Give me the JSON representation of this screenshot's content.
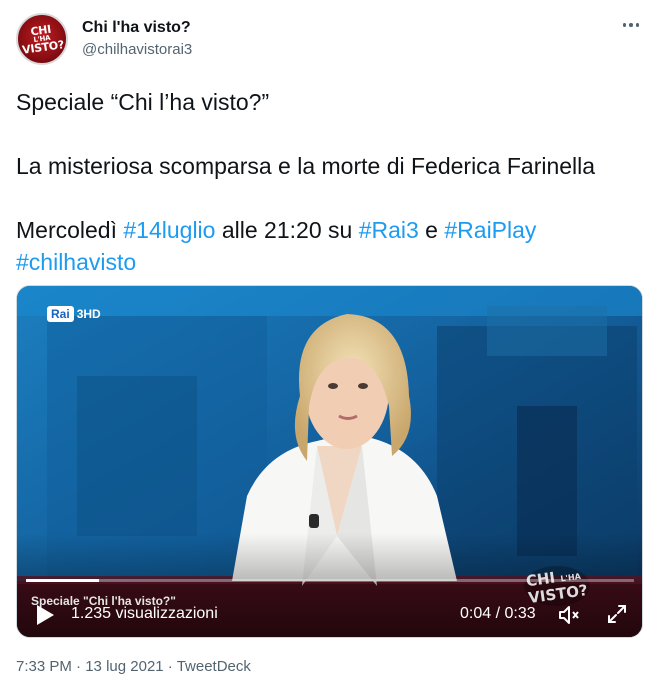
{
  "author": {
    "display_name": "Chi l'ha visto?",
    "handle": "@chilhavistorai3",
    "avatar_text": [
      "CHI",
      "L'HA",
      "VISTO?"
    ],
    "avatar_icon": "chi-lha-visto-logo"
  },
  "more_icon": "ellipsis-icon",
  "tweet": {
    "line1": "Speciale “Chi l’ha visto?”",
    "line2": "La misteriosa scomparsa e la morte di Federica Farinella",
    "line3_prefix": "Mercoledì ",
    "hashtag_date": "#14luglio",
    "line3_mid": " alle 21:20 su ",
    "hashtag_rai3": "#Rai3",
    "line3_conj": " e ",
    "hashtag_raiplay": "#RaiPlay",
    "hashtag_show": "#chilhavisto"
  },
  "video": {
    "channel_logo": "Rai",
    "channel_num": "3HD",
    "lower_third": "Speciale \"Chi l'ha visto?\"",
    "views": "1.235 visualizzazioni",
    "time": "0:04 / 0:33",
    "progress": 0.12,
    "watermark_text": [
      "CHI",
      "L'HA",
      "VISTO?"
    ],
    "play_icon": "play-icon",
    "volume_icon": "volume-muted-icon",
    "fullscreen_icon": "fullscreen-icon"
  },
  "footer": {
    "time": "7:33 PM",
    "sep1": " · ",
    "date": "13 lug 2021",
    "sep2": " · ",
    "source": "TweetDeck"
  },
  "colors": {
    "link": "#1d9bf0",
    "secondary_text": "#536471",
    "primary_text": "#0f1419",
    "avatar_red": "#c01c22"
  }
}
